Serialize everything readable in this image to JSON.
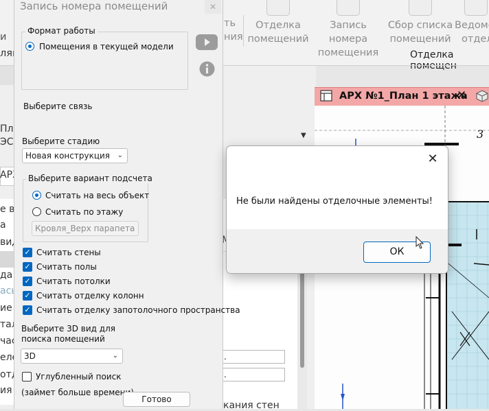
{
  "ribbon": {
    "partial_left_1": "ть",
    "partial_left_2": "ния",
    "buttons": [
      {
        "line1": "Отделка",
        "line2": "помещений"
      },
      {
        "line1": "Запись номера",
        "line2": "помещения"
      },
      {
        "line1": "Сбор списка",
        "line2": "помещений"
      },
      {
        "line1": "Ведомо",
        "line2": "отдел"
      }
    ],
    "panel_caption": "Отделка помещен",
    "left_fragment_1": "и",
    "left_fragment_2": "ляц"
  },
  "background_app": {
    "labels": [
      "Пла",
      "ЭСЕ",
      "АРХ",
      "е ви",
      "а",
      "вид",
      "да",
      "асы",
      "ие",
      "тал",
      "час",
      "еле",
      "отд",
      "ия"
    ],
    "field_dots": [
      ".",
      "."
    ],
    "bottom_text": "кания стен"
  },
  "view_tab": {
    "title": "АРХ №1_План 1 этажа",
    "close_glyph": "✕",
    "plan_number": "3"
  },
  "plugin_window": {
    "title": "Запись номера помещений",
    "close_glyph": "✕",
    "work_format": {
      "group_title": "Формат работы",
      "option": "Помещения в текущей модели"
    },
    "select_link_label": "Выберите связь",
    "select_stage_label": "Выберите стадию",
    "stage_value": "Новая конструкция",
    "count_variant": {
      "group_title": "Выберите вариант подсчета",
      "option_whole": "Считать на весь объект",
      "option_floor": "Считать по этажу",
      "floor_value": "Кровля_Верх парапета"
    },
    "checkboxes": [
      "Считать стены",
      "Считать полы",
      "Считать потолки",
      "Считать отделку колонн",
      "Считать отделку запотолочного пространства"
    ],
    "view3d_label_1": "Выберите 3D вид для",
    "view3d_label_2": "поиска помещений",
    "view3d_value": "3D",
    "deep_search_label": "Углубленный поиск",
    "deep_search_note": "(займет больше времени)",
    "done_button": "Готово"
  },
  "dialog": {
    "message": "Не были найдены отделочные элементы!",
    "ok_label": "ОК",
    "close_glyph": "✕"
  },
  "colors": {
    "accent": "#0067c0",
    "tab_active": "#f4a7a7",
    "plan_cyan": "#c7e6ef"
  },
  "icons": [
    "youtube-icon",
    "info-icon",
    "checkmark-icon",
    "chevron-down-icon",
    "close-icon",
    "floor-plan-icon",
    "3d-view-icon",
    "mouse-cursor-icon"
  ]
}
